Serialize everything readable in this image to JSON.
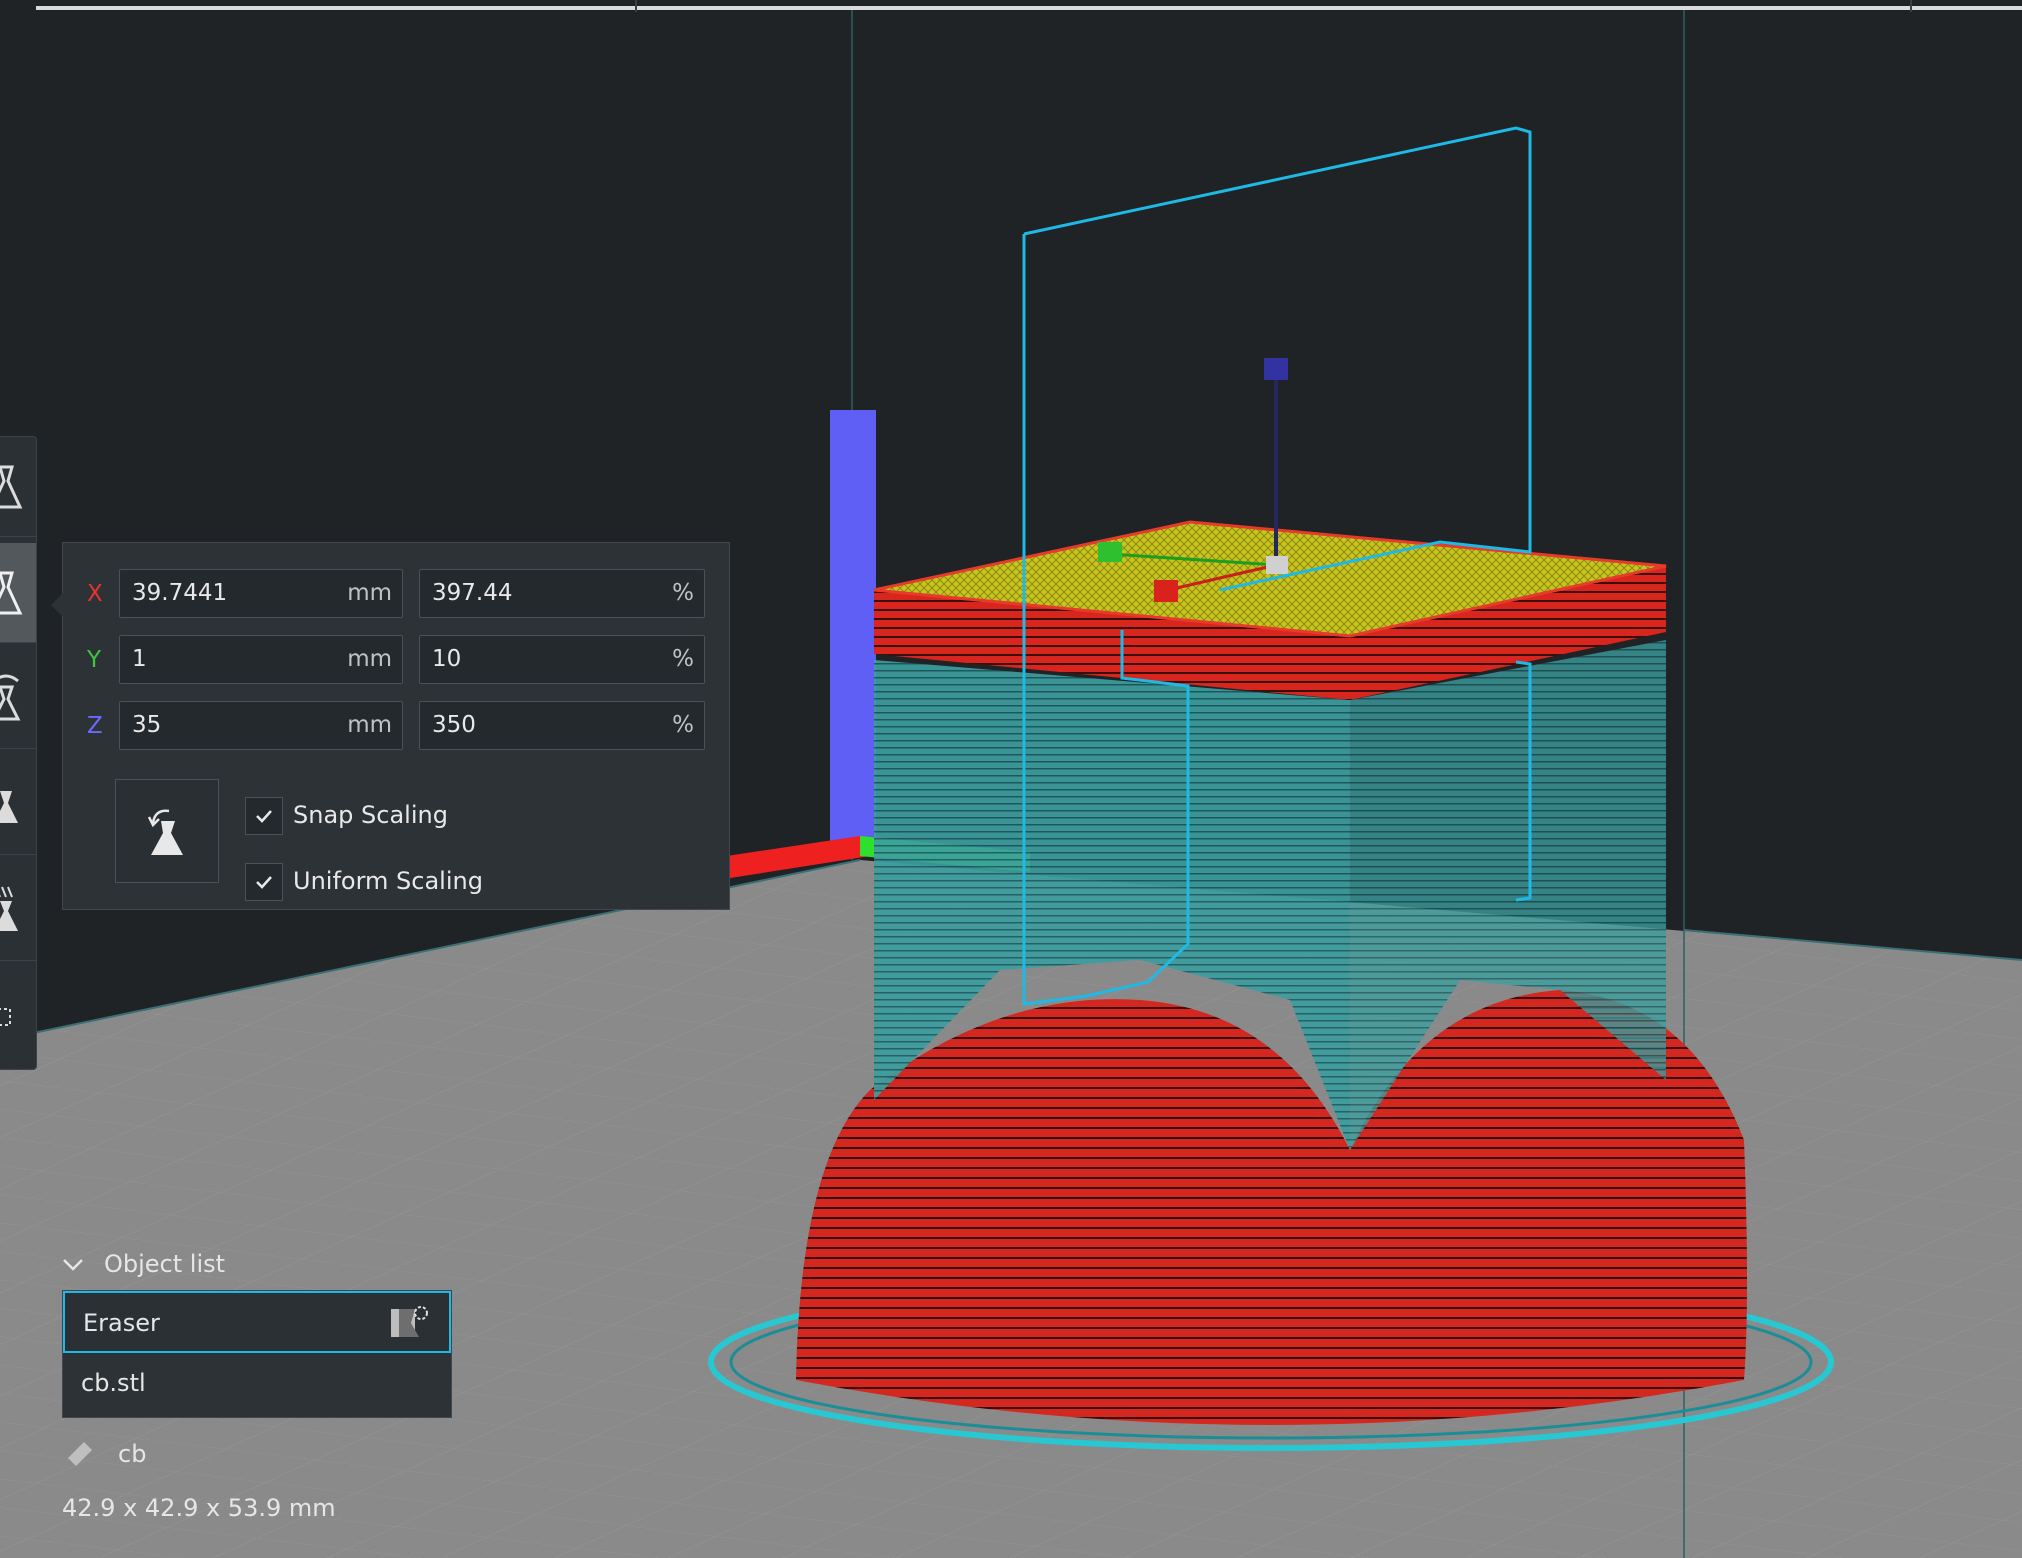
{
  "scale_panel": {
    "x": {
      "label": "X",
      "mm": "39.7441",
      "percent": "397.44",
      "color": "#e8322d"
    },
    "y": {
      "label": "Y",
      "mm": "1",
      "percent": "10",
      "color": "#3cc83c"
    },
    "z": {
      "label": "Z",
      "mm": "35",
      "percent": "350",
      "color": "#6a6aff"
    },
    "unit_mm": "mm",
    "unit_percent": "%",
    "snap_scaling": {
      "label": "Snap Scaling",
      "checked": true
    },
    "uniform_scaling": {
      "label": "Uniform Scaling",
      "checked": true
    },
    "reset_icon": "scale-reset-icon"
  },
  "object_list": {
    "header": "Object list",
    "items": [
      {
        "name": "Eraser",
        "selected": true,
        "icon": "eraser-mesh-icon"
      },
      {
        "name": "cb.stl",
        "selected": false
      }
    ]
  },
  "selected_object": {
    "name": "cb",
    "dimensions": "42.9 x 42.9 x 53.9 mm"
  },
  "colors": {
    "accent": "#1fb9e6",
    "model_red": "#d8251d",
    "model_cyan": "#3a9c9c",
    "top_yellow": "#c8c81e",
    "build_plate": "#8a8a8a",
    "background": "#1f2326"
  }
}
